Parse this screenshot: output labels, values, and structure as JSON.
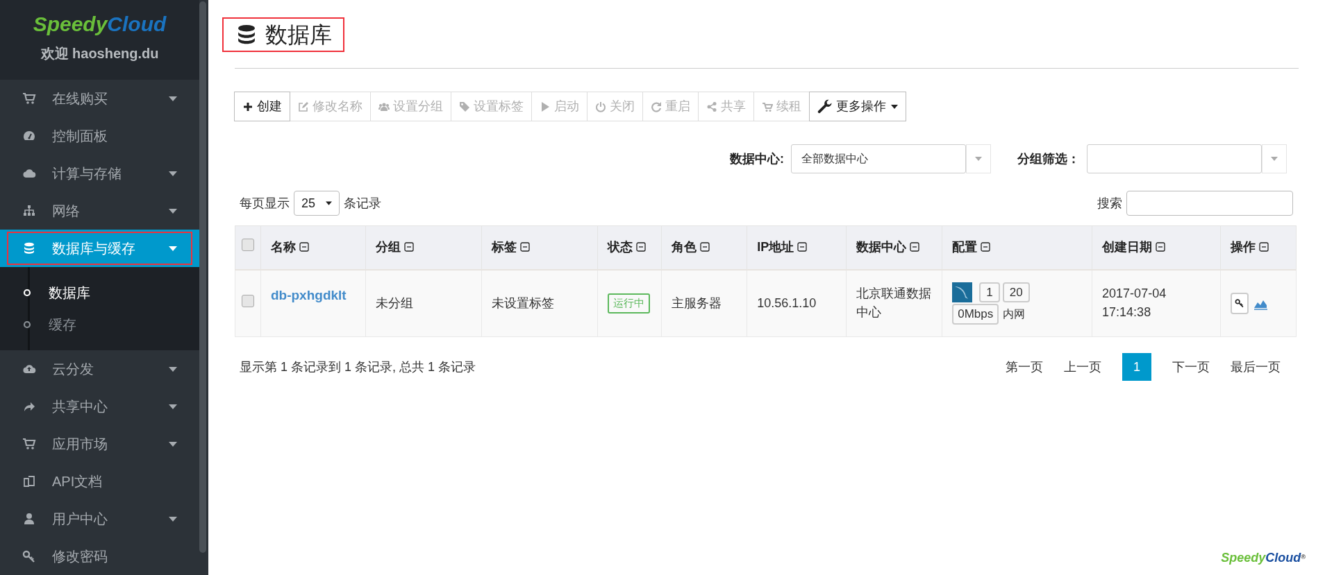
{
  "sidebar": {
    "logo": {
      "part_1": "Speedy",
      "part_2": "Cloud"
    },
    "welcome": "欢迎 haosheng.du",
    "items": [
      {
        "kind": "group",
        "label": "在线购买",
        "expanded": false,
        "selected": false,
        "highlighted": false
      },
      {
        "kind": "link",
        "label": "控制面板",
        "selected": false,
        "highlighted": false
      },
      {
        "kind": "group",
        "label": "计算与存储",
        "expanded": false,
        "selected": false,
        "highlighted": false
      },
      {
        "kind": "group",
        "label": "网络",
        "expanded": false,
        "selected": false,
        "highlighted": false
      },
      {
        "kind": "group",
        "label": "数据库与缓存",
        "expanded": true,
        "selected": true,
        "highlighted": true,
        "children": [
          {
            "label": "数据库",
            "selected": true
          },
          {
            "label": "缓存",
            "selected": false
          }
        ]
      },
      {
        "kind": "group",
        "label": "云分发",
        "expanded": false,
        "selected": false,
        "highlighted": false
      },
      {
        "kind": "group",
        "label": "共享中心",
        "expanded": false,
        "selected": false,
        "highlighted": false
      },
      {
        "kind": "group",
        "label": "应用市场",
        "expanded": false,
        "selected": false,
        "highlighted": false
      },
      {
        "kind": "link",
        "label": "API文档",
        "selected": false,
        "highlighted": false
      },
      {
        "kind": "group",
        "label": "用户中心",
        "expanded": false,
        "selected": false,
        "highlighted": false
      },
      {
        "kind": "link",
        "label": "修改密码",
        "selected": false,
        "highlighted": false
      }
    ]
  },
  "page_title": {
    "text": "数据库",
    "highlighted": true
  },
  "toolbar": [
    {
      "kind": "button",
      "label": "创建",
      "disabled": false
    },
    {
      "kind": "button",
      "label": "修改名称",
      "disabled": true
    },
    {
      "kind": "button",
      "label": "设置分组",
      "disabled": true
    },
    {
      "kind": "button",
      "label": "设置标签",
      "disabled": true
    },
    {
      "kind": "button",
      "label": "启动",
      "disabled": true
    },
    {
      "kind": "button",
      "label": "关闭",
      "disabled": true
    },
    {
      "kind": "button",
      "label": "重启",
      "disabled": true
    },
    {
      "kind": "button",
      "label": "共享",
      "disabled": true
    },
    {
      "kind": "button",
      "label": "续租",
      "disabled": true
    },
    {
      "kind": "dropdown",
      "label": "更多操作",
      "disabled": false
    }
  ],
  "filters": [
    {
      "label": "数据中心:",
      "value": "全部数据中心"
    },
    {
      "label": "分组筛选："
    }
  ],
  "page_length": {
    "prefix": "每页显示",
    "value": "25",
    "suffix": "条记录"
  },
  "search": {
    "label": "搜索"
  },
  "table": {
    "header_checked": false,
    "columns": [
      {
        "label": "名称"
      },
      {
        "label": "分组"
      },
      {
        "label": "标签"
      },
      {
        "label": "状态"
      },
      {
        "label": "角色"
      },
      {
        "label": "IP地址"
      },
      {
        "label": "数据中心"
      },
      {
        "label": "配置"
      },
      {
        "label": "创建日期"
      },
      {
        "label": "操作"
      }
    ],
    "rows": [
      {
        "checked": false,
        "name": "db-pxhgdklt",
        "group": "未分组",
        "tag": "未设置标签",
        "status": "运行中",
        "role": "主服务器",
        "ip": "10.56.1.10",
        "datacenter": "北京联通数据中心",
        "config": {
          "cpu": "1",
          "memory": "20",
          "bandwidth": "0Mbps",
          "network": "内网"
        },
        "created": "2017-07-04 17:14:38"
      }
    ]
  },
  "table_info": "显示第 1 条记录到 1 条记录, 总共 1 条记录",
  "pagination": [
    {
      "label": "第一页",
      "selected": false
    },
    {
      "label": "上一页",
      "selected": false
    },
    {
      "label": "1",
      "selected": true
    },
    {
      "label": "下一页",
      "selected": false
    },
    {
      "label": "最后一页",
      "selected": false
    }
  ],
  "footer_logo": {
    "part_1": "Speedy",
    "part_2": "Cloud",
    "mark": "®"
  }
}
